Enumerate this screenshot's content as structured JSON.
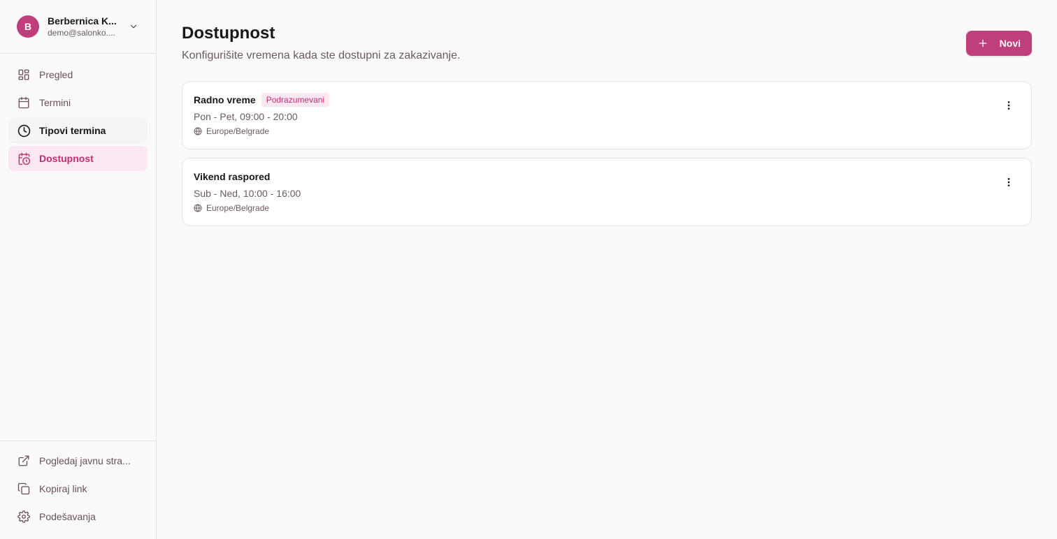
{
  "account": {
    "initial": "B",
    "name": "Berbernica K...",
    "email": "demo@salonko...."
  },
  "nav": {
    "items": [
      {
        "label": "Pregled",
        "icon": "grid-icon"
      },
      {
        "label": "Termini",
        "icon": "calendar-icon"
      },
      {
        "label": "Tipovi termina",
        "icon": "clock-icon"
      },
      {
        "label": "Dostupnost",
        "icon": "calendar-clock-icon"
      }
    ],
    "bottom": [
      {
        "label": "Pogledaj javnu stra...",
        "icon": "external-link-icon"
      },
      {
        "label": "Kopiraj link",
        "icon": "copy-icon"
      },
      {
        "label": "Podešavanja",
        "icon": "gear-icon"
      }
    ]
  },
  "page": {
    "title": "Dostupnost",
    "subtitle": "Konfigurišite vremena kada ste dostupni za zakazivanje.",
    "new_button": "Novi"
  },
  "schedules": [
    {
      "name": "Radno vreme",
      "badge": "Podrazumevani",
      "hours": "Pon - Pet, 09:00 - 20:00",
      "timezone": "Europe/Belgrade"
    },
    {
      "name": "Vikend raspored",
      "hours": "Sub - Ned, 10:00 - 16:00",
      "timezone": "Europe/Belgrade"
    }
  ],
  "colors": {
    "accent": "#be3f7c",
    "active_bg": "#fbe7f1",
    "active_text": "#be2f6e"
  }
}
